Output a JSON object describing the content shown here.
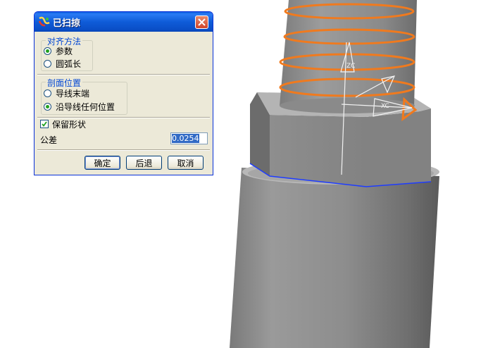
{
  "dialog": {
    "title": "已扫掠",
    "close_glyph": "×",
    "alignment_group": {
      "label": "对齐方法",
      "options": [
        "参数",
        "圆弧长"
      ],
      "selected": "参数"
    },
    "section_group": {
      "label": "剖面位置",
      "options": [
        "导线末端",
        "沿导线任何位置"
      ],
      "selected": "沿导线任何位置"
    },
    "keep_shape": {
      "label": "保留形状",
      "checked": true
    },
    "tolerance": {
      "label": "公差",
      "value": "0.0254"
    },
    "buttons": {
      "ok": "确定",
      "back": "后退",
      "cancel": "取消"
    }
  },
  "viewport": {
    "axis_labels": {
      "z": "ZC",
      "x": "XC"
    },
    "colors": {
      "helix": "#F07A1E",
      "edge_highlight": "#1E3CFF",
      "dialog_title": "#0A4EC6",
      "selection": "#316AC5"
    }
  }
}
